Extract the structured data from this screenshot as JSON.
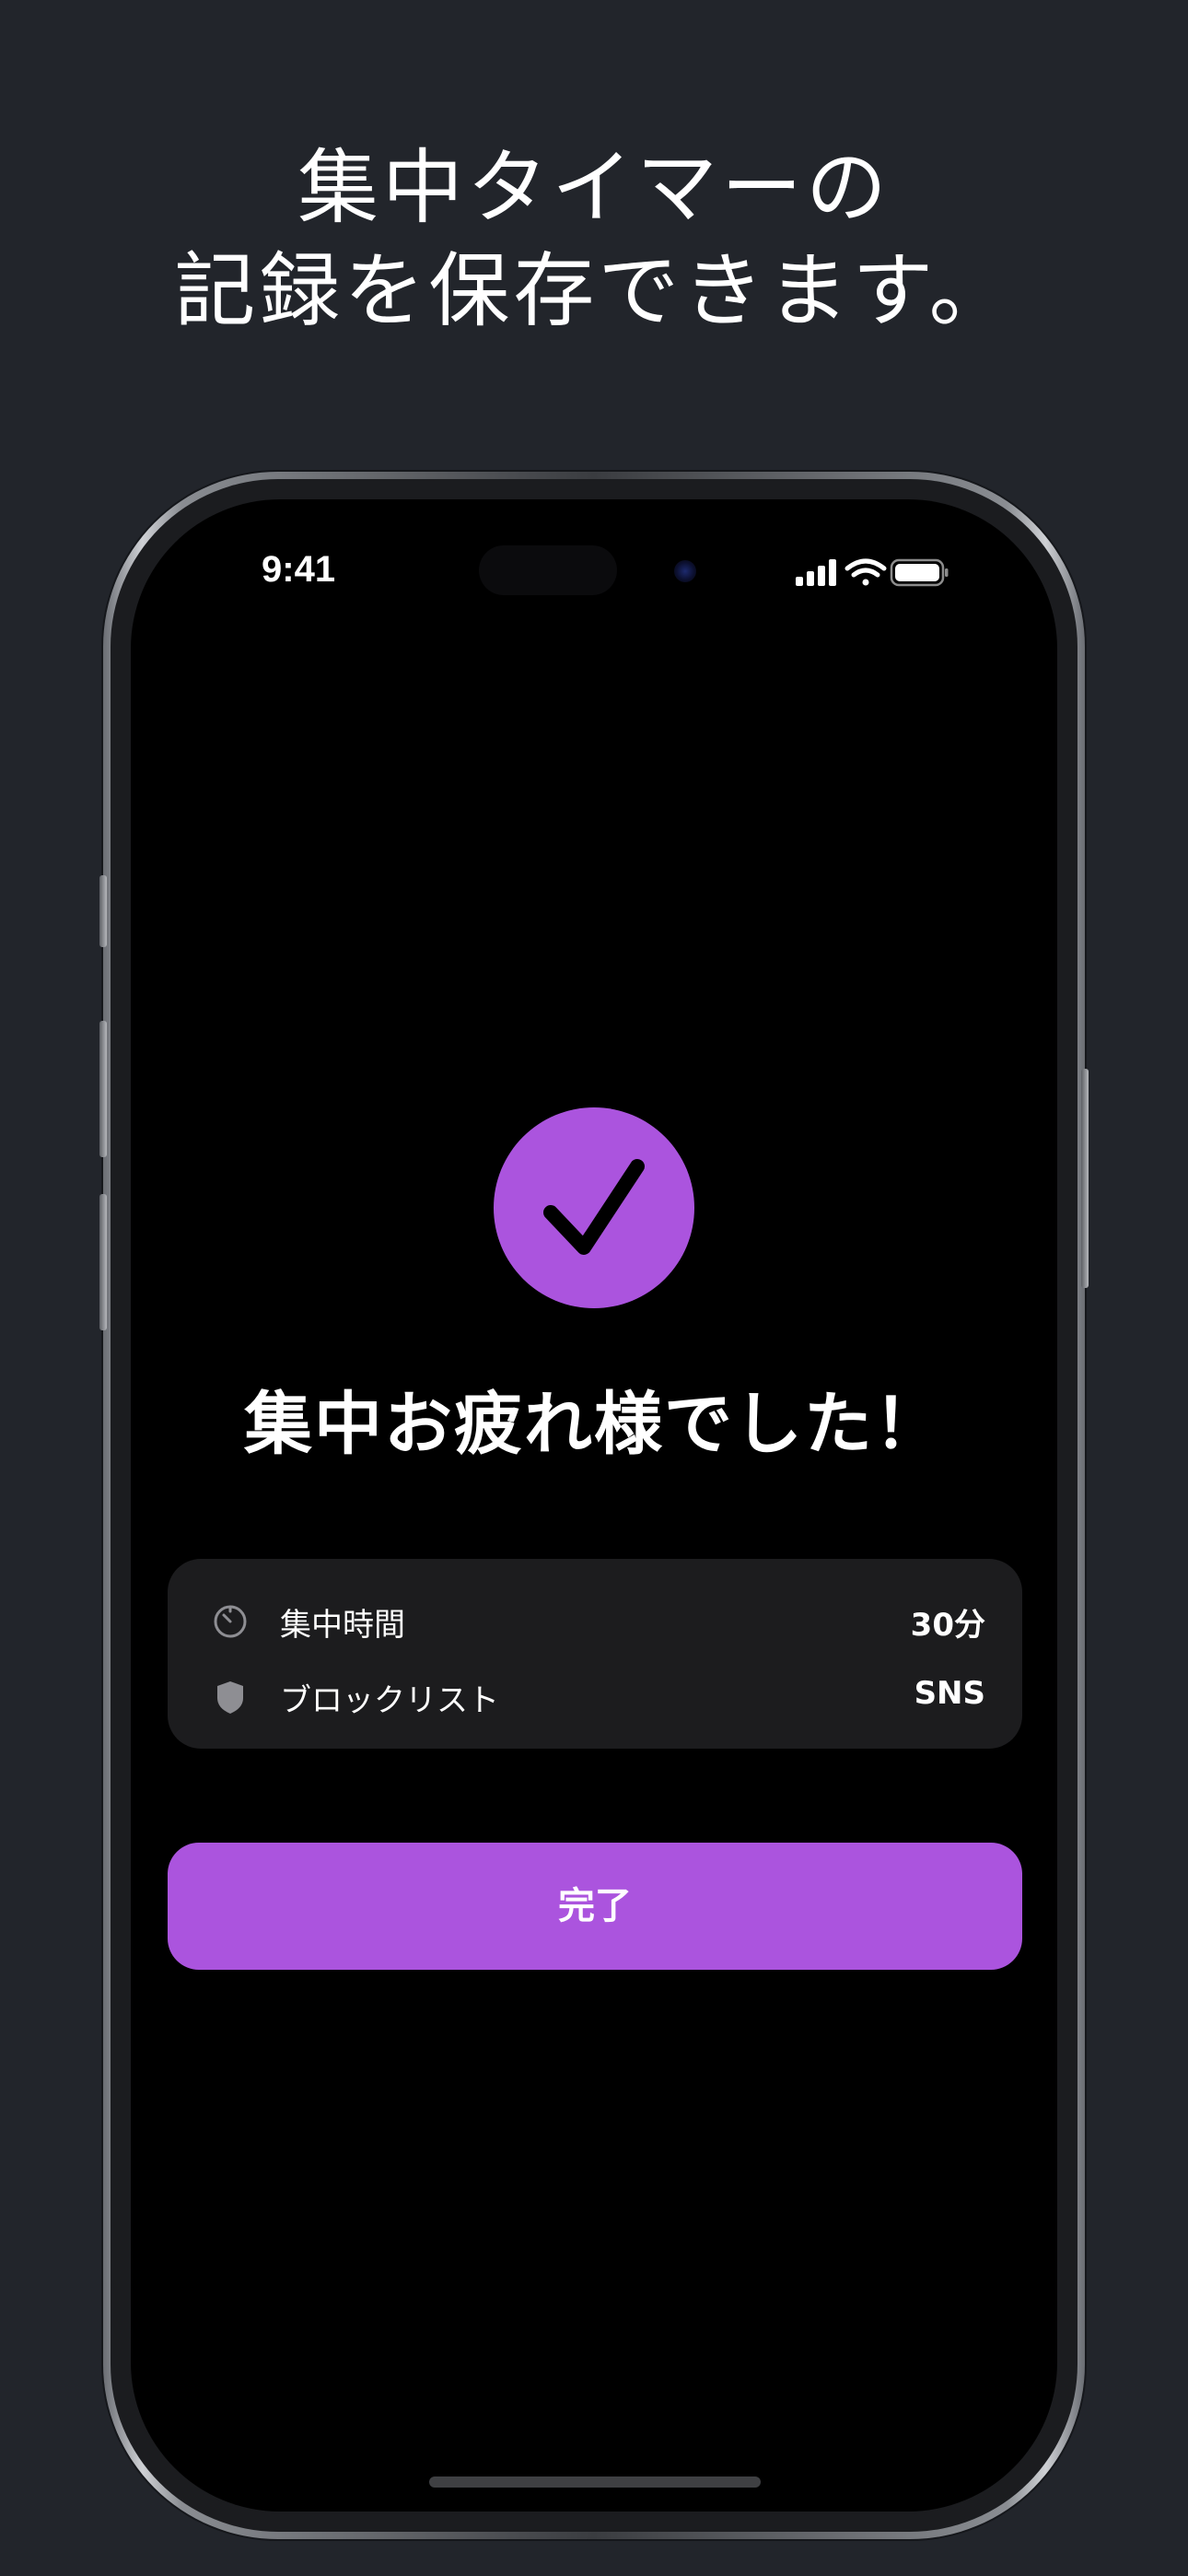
{
  "headline": {
    "line1": "集中タイマーの",
    "line2": "記録を保存できます。"
  },
  "status_bar": {
    "time": "9:41",
    "icons": [
      "cellular-signal-icon",
      "wifi-icon",
      "battery-icon"
    ]
  },
  "completion": {
    "icon": "checkmark-icon",
    "title": "集中お疲れ様でした！"
  },
  "summary": {
    "rows": [
      {
        "icon": "timer-icon",
        "label": "集中時間",
        "value": "30分"
      },
      {
        "icon": "shield-icon",
        "label": "ブロックリスト",
        "value": "SNS"
      }
    ]
  },
  "button": {
    "label": "完了"
  },
  "colors": {
    "background": "#22252b",
    "screen": "#000000",
    "accent": "#ab54de",
    "card": "#1c1c1e",
    "text": "#ffffff",
    "icon_gray": "#8e8e93"
  }
}
